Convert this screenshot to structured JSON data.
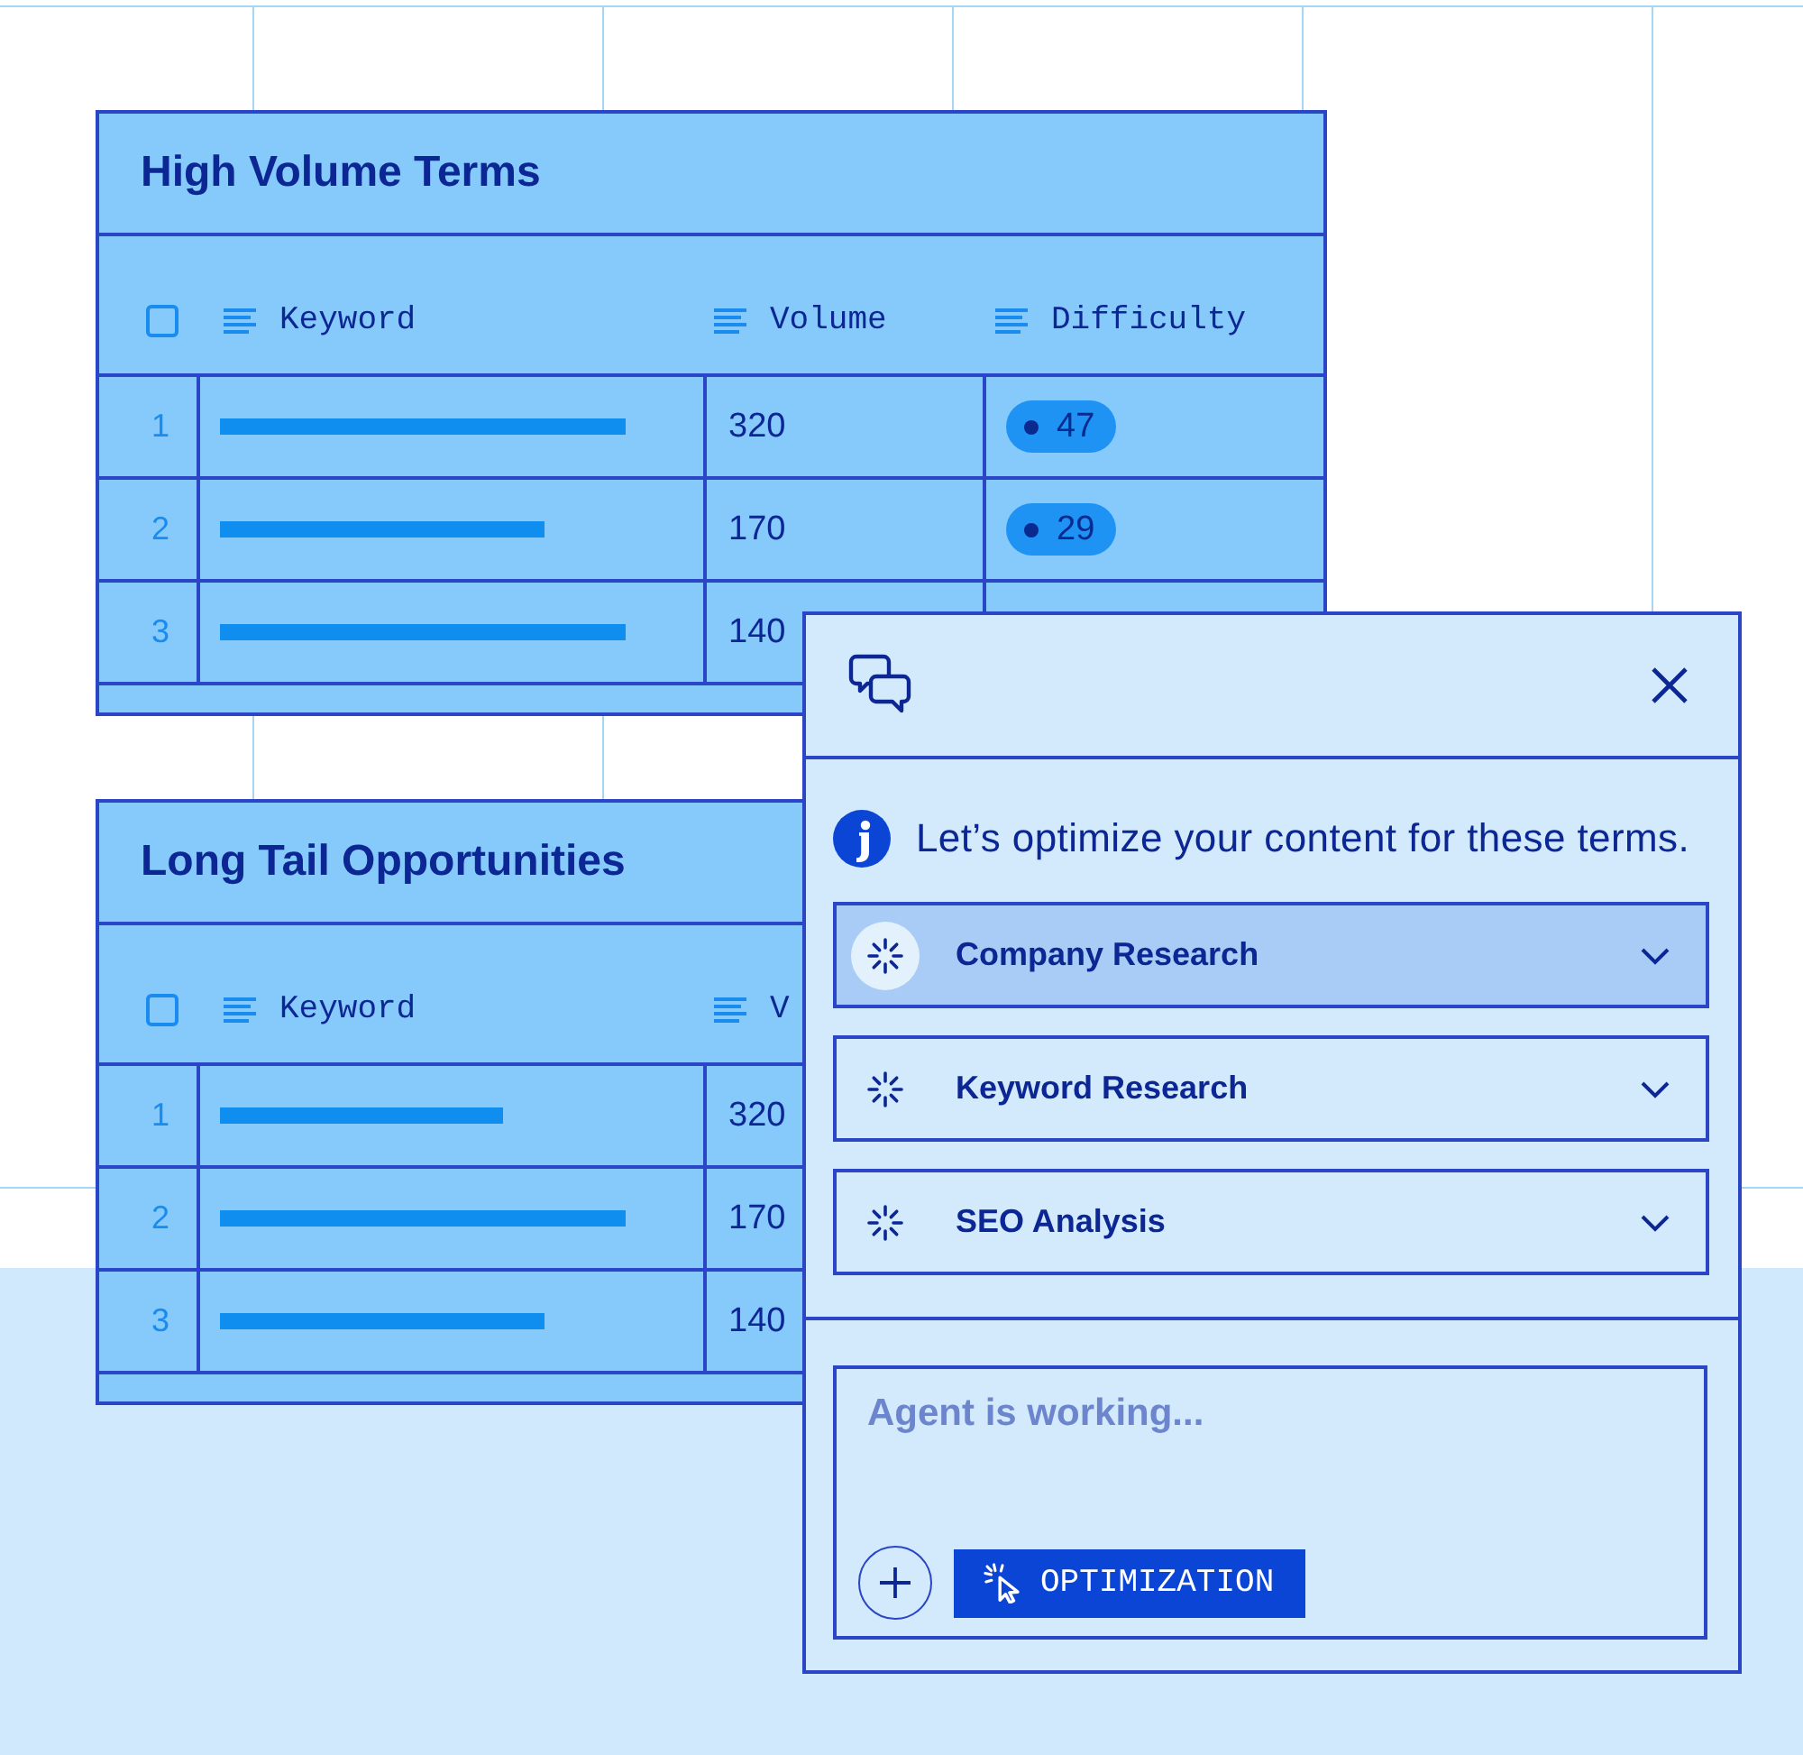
{
  "tables": [
    {
      "title": "High Volume Terms",
      "select_all": {
        "checked": false
      },
      "columns": [
        {
          "label": "Keyword"
        },
        {
          "label": "Volume"
        },
        {
          "label": "Difficulty"
        }
      ],
      "rows": [
        {
          "number": "1",
          "keyword_bar": {
            "kind": "long"
          },
          "volume": "320",
          "difficulty": "47"
        },
        {
          "number": "2",
          "keyword_bar": {
            "kind": "medium"
          },
          "volume": "170",
          "difficulty": "29"
        },
        {
          "number": "3",
          "keyword_bar": {
            "kind": "long"
          },
          "volume": "140"
        }
      ]
    },
    {
      "title": "Long Tail Opportunities",
      "select_all": {
        "checked": false
      },
      "columns": [
        {
          "label": "Keyword"
        },
        {
          "label": "V"
        }
      ],
      "rows": [
        {
          "number": "1",
          "keyword_bar": {
            "kind": "short"
          },
          "volume": "320"
        },
        {
          "number": "2",
          "keyword_bar": {
            "kind": "long"
          },
          "volume": "170"
        },
        {
          "number": "3",
          "keyword_bar": {
            "kind": "medium"
          },
          "volume": "140"
        }
      ]
    }
  ],
  "chat_panel": {
    "message": "Let’s optimize your content for these terms.",
    "steps": [
      {
        "label": "Company Research",
        "selected": true
      },
      {
        "label": "Keyword Research",
        "selected": false
      },
      {
        "label": "SEO Analysis",
        "selected": false
      }
    ],
    "composer": {
      "placeholder": "Agent is working...",
      "mode_button": "OPTIMIZATION"
    }
  }
}
